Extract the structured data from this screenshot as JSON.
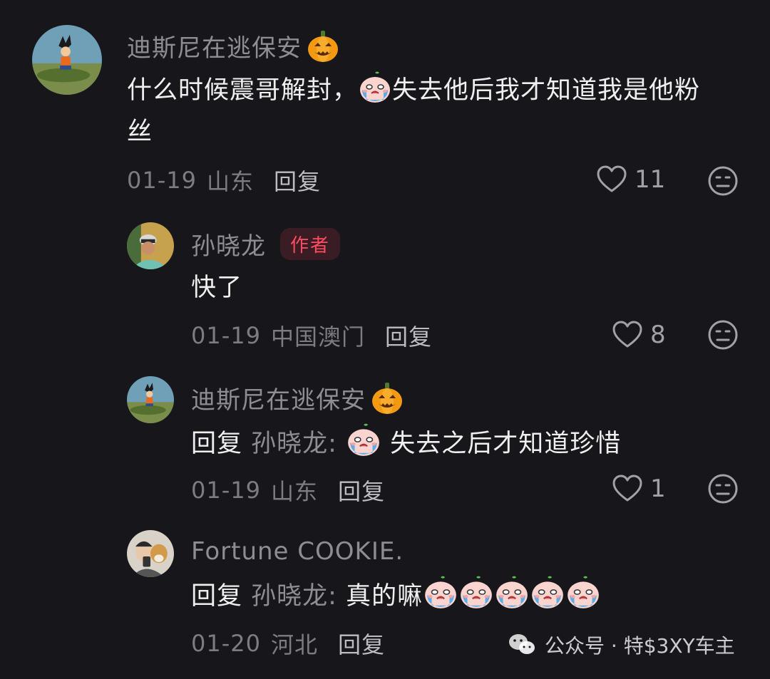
{
  "comments": [
    {
      "author": "迪斯尼在逃保安",
      "text_part1": "什么时候震哥解封，",
      "text_part2": "失去他后我才知道我是他粉",
      "text_part3": "丝",
      "date": "01-19",
      "location": "山东",
      "reply_label": "回复",
      "likes": "11"
    },
    {
      "author": "孙晓龙",
      "badge": "作者",
      "text": "快了",
      "date": "01-19",
      "location": "中国澳门",
      "reply_label": "回复",
      "likes": "8"
    },
    {
      "author": "迪斯尼在逃保安",
      "reply_prefix": "回复",
      "reply_to": "孙晓龙:",
      "text": "失去之后才知道珍惜",
      "date": "01-19",
      "location": "山东",
      "reply_label": "回复",
      "likes": "1"
    },
    {
      "author": "Fortune COOKIE.",
      "reply_prefix": "回复",
      "reply_to": "孙晓龙:",
      "text": "真的嘛",
      "date": "01-20",
      "location": "河北",
      "reply_label": "回复"
    }
  ],
  "watermark": {
    "text": "公众号 · 特$3XY车主",
    "icon": "wechat-icon"
  },
  "icons": {
    "like": "heart-outline-icon",
    "dislike": "neutral-face-icon",
    "badge_emoji": "pumpkin-icon",
    "crying": "crying-face-icon"
  },
  "colors": {
    "background": "#17161b",
    "author_badge": "#ff4b60"
  }
}
